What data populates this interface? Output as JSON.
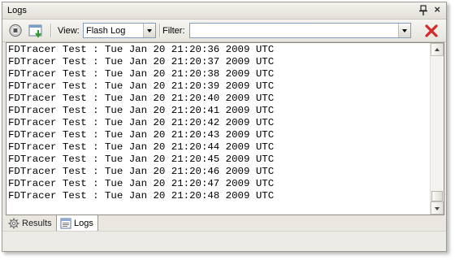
{
  "window": {
    "title": "Logs"
  },
  "toolbar": {
    "view_label": "View:",
    "view_value": "Flash Log",
    "filter_label": "Filter:",
    "filter_value": ""
  },
  "log": {
    "lines": [
      "FDTracer Test : Tue Jan 20 21:20:36 2009 UTC",
      "FDTracer Test : Tue Jan 20 21:20:37 2009 UTC",
      "FDTracer Test : Tue Jan 20 21:20:38 2009 UTC",
      "FDTracer Test : Tue Jan 20 21:20:39 2009 UTC",
      "FDTracer Test : Tue Jan 20 21:20:40 2009 UTC",
      "FDTracer Test : Tue Jan 20 21:20:41 2009 UTC",
      "FDTracer Test : Tue Jan 20 21:20:42 2009 UTC",
      "FDTracer Test : Tue Jan 20 21:20:43 2009 UTC",
      "FDTracer Test : Tue Jan 20 21:20:44 2009 UTC",
      "FDTracer Test : Tue Jan 20 21:20:45 2009 UTC",
      "FDTracer Test : Tue Jan 20 21:20:46 2009 UTC",
      "FDTracer Test : Tue Jan 20 21:20:47 2009 UTC",
      "FDTracer Test : Tue Jan 20 21:20:48 2009 UTC"
    ]
  },
  "tabs": [
    {
      "label": "Results",
      "icon": "gear-icon",
      "active": false
    },
    {
      "label": "Logs",
      "icon": "log-document-icon",
      "active": true
    }
  ],
  "icons": {
    "pin": "pin-icon",
    "close": "close-icon",
    "stop": "stop-icon",
    "export": "export-icon",
    "clear": "clear-red-x-icon"
  },
  "colors": {
    "clear_red": "#d42a2a",
    "panel_bg": "#e9e7e0"
  }
}
